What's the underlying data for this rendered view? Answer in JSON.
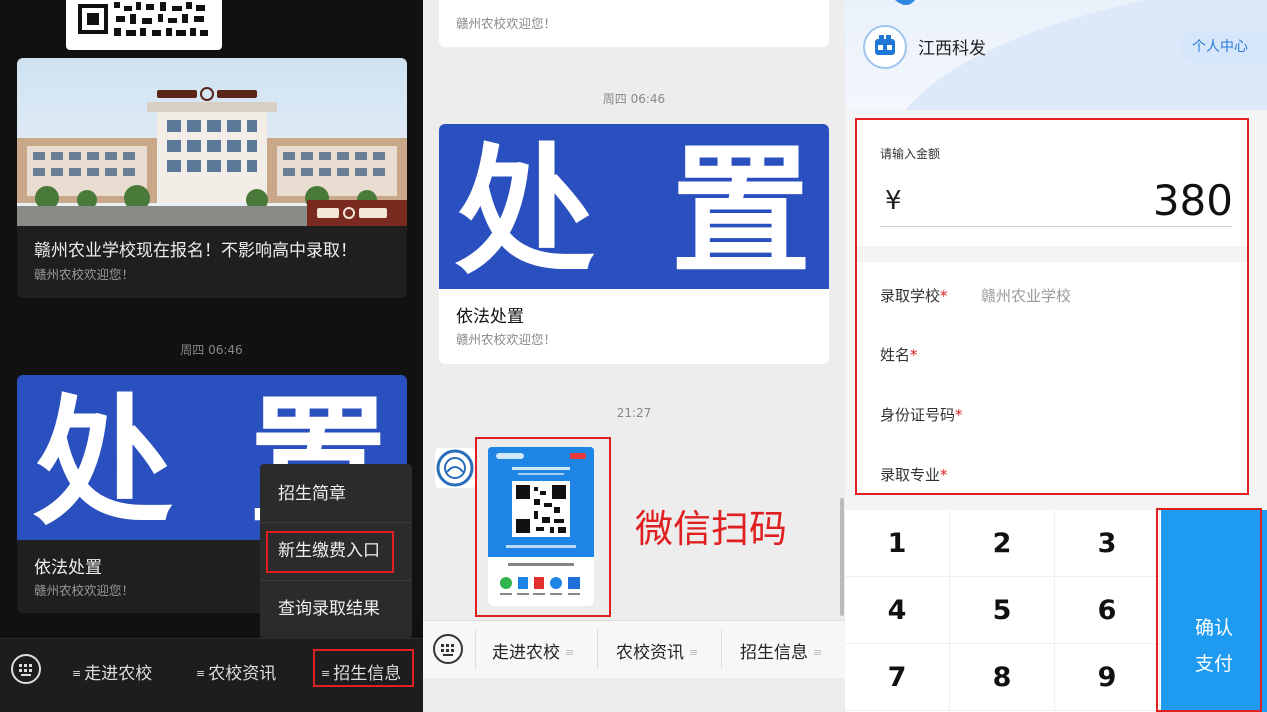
{
  "panel1": {
    "card1": {
      "title": "赣州农业学校现在报名！不影响高中录取！",
      "subtitle": "赣州农校欢迎您！"
    },
    "time1": "周四 06:46",
    "card2": {
      "banner_chars": [
        "处",
        "置"
      ],
      "title": "依法处置",
      "subtitle": "赣州农校欢迎您！"
    },
    "menu": [
      "招生简章",
      "新生缴费入口",
      "查询录取结果"
    ],
    "nav": [
      "走进农校",
      "农校资讯",
      "招生信息"
    ]
  },
  "panel2": {
    "top_subtitle": "赣州农校欢迎您！",
    "time1": "周四 06:46",
    "card": {
      "banner_chars": [
        "处",
        "置"
      ],
      "title": "依法处置",
      "subtitle": "赣州农校欢迎您！"
    },
    "time2": "21:27",
    "annotation": "微信扫码",
    "nav": [
      "走进农校",
      "农校资讯",
      "招生信息"
    ]
  },
  "panel3": {
    "brand": "江西科发",
    "profile_button": "个人中心",
    "amount_label": "请输入金额",
    "currency": "¥",
    "amount": "380",
    "fields": [
      {
        "label": "录取学校",
        "value": "赣州农业学校"
      },
      {
        "label": "姓名",
        "value": ""
      },
      {
        "label": "身份证号码",
        "value": ""
      },
      {
        "label": "录取专业",
        "value": ""
      }
    ],
    "required_mark": "*",
    "keys": [
      "1",
      "2",
      "3",
      "4",
      "5",
      "6",
      "7",
      "8",
      "9"
    ],
    "confirm_line1": "确认",
    "confirm_line2": "支付"
  },
  "colors": {
    "highlight": "#e02020",
    "banner_blue": "#2a50bf",
    "pay_blue": "#1e9af0"
  }
}
